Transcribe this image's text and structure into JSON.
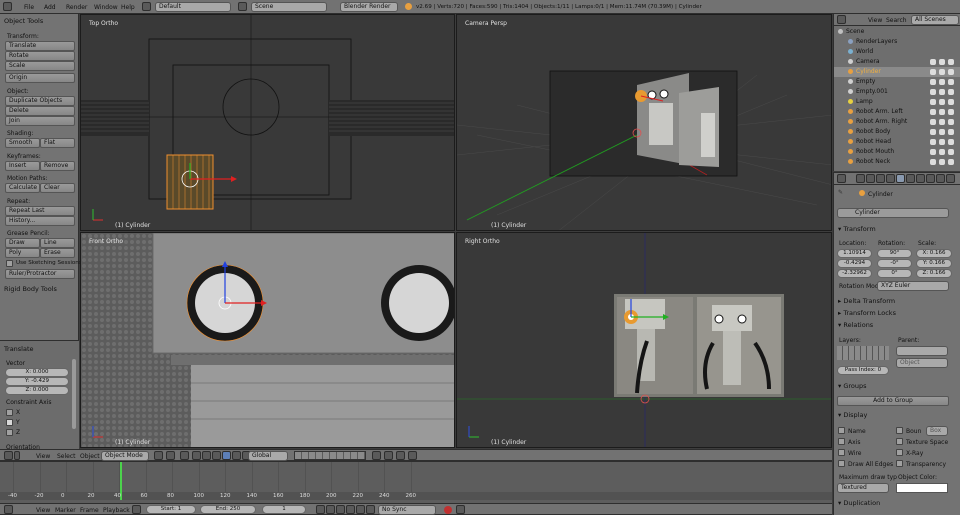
{
  "topbar": {
    "menus": [
      "File",
      "Add",
      "Render",
      "Window",
      "Help"
    ],
    "layout": "Default",
    "scene": "Scene",
    "engine": "Blender Render",
    "stats": "v2.69 | Verts:720 | Faces:590 | Tris:1404 | Objects:1/11 | Lamps:0/1 | Mem:11.74M (70.39M) | Cylinder"
  },
  "toolshelf": {
    "title": "Object Tools",
    "transform_label": "Transform:",
    "translate": "Translate",
    "rotate": "Rotate",
    "scale": "Scale",
    "origin": "Origin",
    "object_label": "Object:",
    "duplicate": "Duplicate Objects",
    "delete": "Delete",
    "join": "Join",
    "shading_label": "Shading:",
    "smooth": "Smooth",
    "flat": "Flat",
    "keyframes_label": "Keyframes:",
    "insert": "Insert",
    "remove": "Remove",
    "motion_label": "Motion Paths:",
    "calculate": "Calculate",
    "clear": "Clear",
    "repeat_label": "Repeat:",
    "repeat_last": "Repeat Last",
    "history": "History...",
    "grease_label": "Grease Pencil:",
    "draw": "Draw",
    "line": "Line",
    "poly": "Poly",
    "erase": "Erase",
    "sketch": "Use Sketching Sessions",
    "ruler": "Ruler/Protractor",
    "rigid": "Rigid Body Tools"
  },
  "operator": {
    "title": "Translate",
    "vector_label": "Vector",
    "x": "X: 0.000",
    "y": "Y: -0.429",
    "z": "Z: 0.000",
    "constraint_label": "Constraint Axis",
    "cx": "X",
    "cy": "Y",
    "cz": "Z",
    "orientation_label": "Orientation"
  },
  "viewports": {
    "tl": "Top Ortho",
    "tr": "Camera Persp",
    "bl": "Front Ortho",
    "br": "Right Ortho",
    "obj": "(1) Cylinder"
  },
  "viewheader": {
    "view": "View",
    "select": "Select",
    "object": "Object",
    "mode": "Object Mode",
    "orientation": "Global"
  },
  "outliner": {
    "view": "View",
    "search": "Search",
    "filter": "All Scenes",
    "items": [
      "Scene",
      "RenderLayers",
      "World",
      "Camera",
      "Cylinder",
      "Empty",
      "Empty.001",
      "Lamp",
      "Robot Arm. Left",
      "Robot Arm. Right",
      "Robot Body",
      "Robot Head",
      "Robot Mouth",
      "Robot Neck"
    ]
  },
  "properties": {
    "breadcrumb": "Cylinder",
    "name": "Cylinder",
    "transform": "Transform",
    "location": "Location:",
    "rotation": "Rotation:",
    "scale": "Scale:",
    "loc": [
      "1.10914",
      "-0.4294",
      "-2.32962"
    ],
    "rot": [
      "90°",
      "-0°",
      "0°"
    ],
    "scl": [
      "X: 0.166",
      "Y: 0.166",
      "Z: 0.166"
    ],
    "rotmode_label": "Rotation Mod",
    "rotmode": "XYZ Euler",
    "delta": "Delta Transform",
    "locks": "Transform Locks",
    "relations": "Relations",
    "layers": "Layers:",
    "parent": "Parent:",
    "parent_type": "Object",
    "pass_index": "Pass Index: 0",
    "groups": "Groups",
    "add_group": "Add to Group",
    "display": "Display",
    "name_opt": "Name",
    "axis": "Axis",
    "wire": "Wire",
    "drawall": "Draw All Edges",
    "bounds": "Boun",
    "box": "Box",
    "texspace": "Texture Space",
    "xray": "X-Ray",
    "transparency": "Transparency",
    "maxdraw": "Maximum draw typ",
    "objcolor": "Object Color:",
    "textured": "Textured",
    "duplication": "Duplication"
  },
  "timeline": {
    "ticks": [
      "-40",
      "-20",
      "0",
      "20",
      "40",
      "60",
      "80",
      "100",
      "120",
      "140",
      "160",
      "180",
      "200",
      "220",
      "240",
      "260"
    ],
    "start": "Start: 1",
    "end": "End: 250",
    "frame": "1",
    "sync": "No Sync",
    "view": "View",
    "marker": "Marker",
    "frame_menu": "Frame",
    "playback": "Playback"
  }
}
